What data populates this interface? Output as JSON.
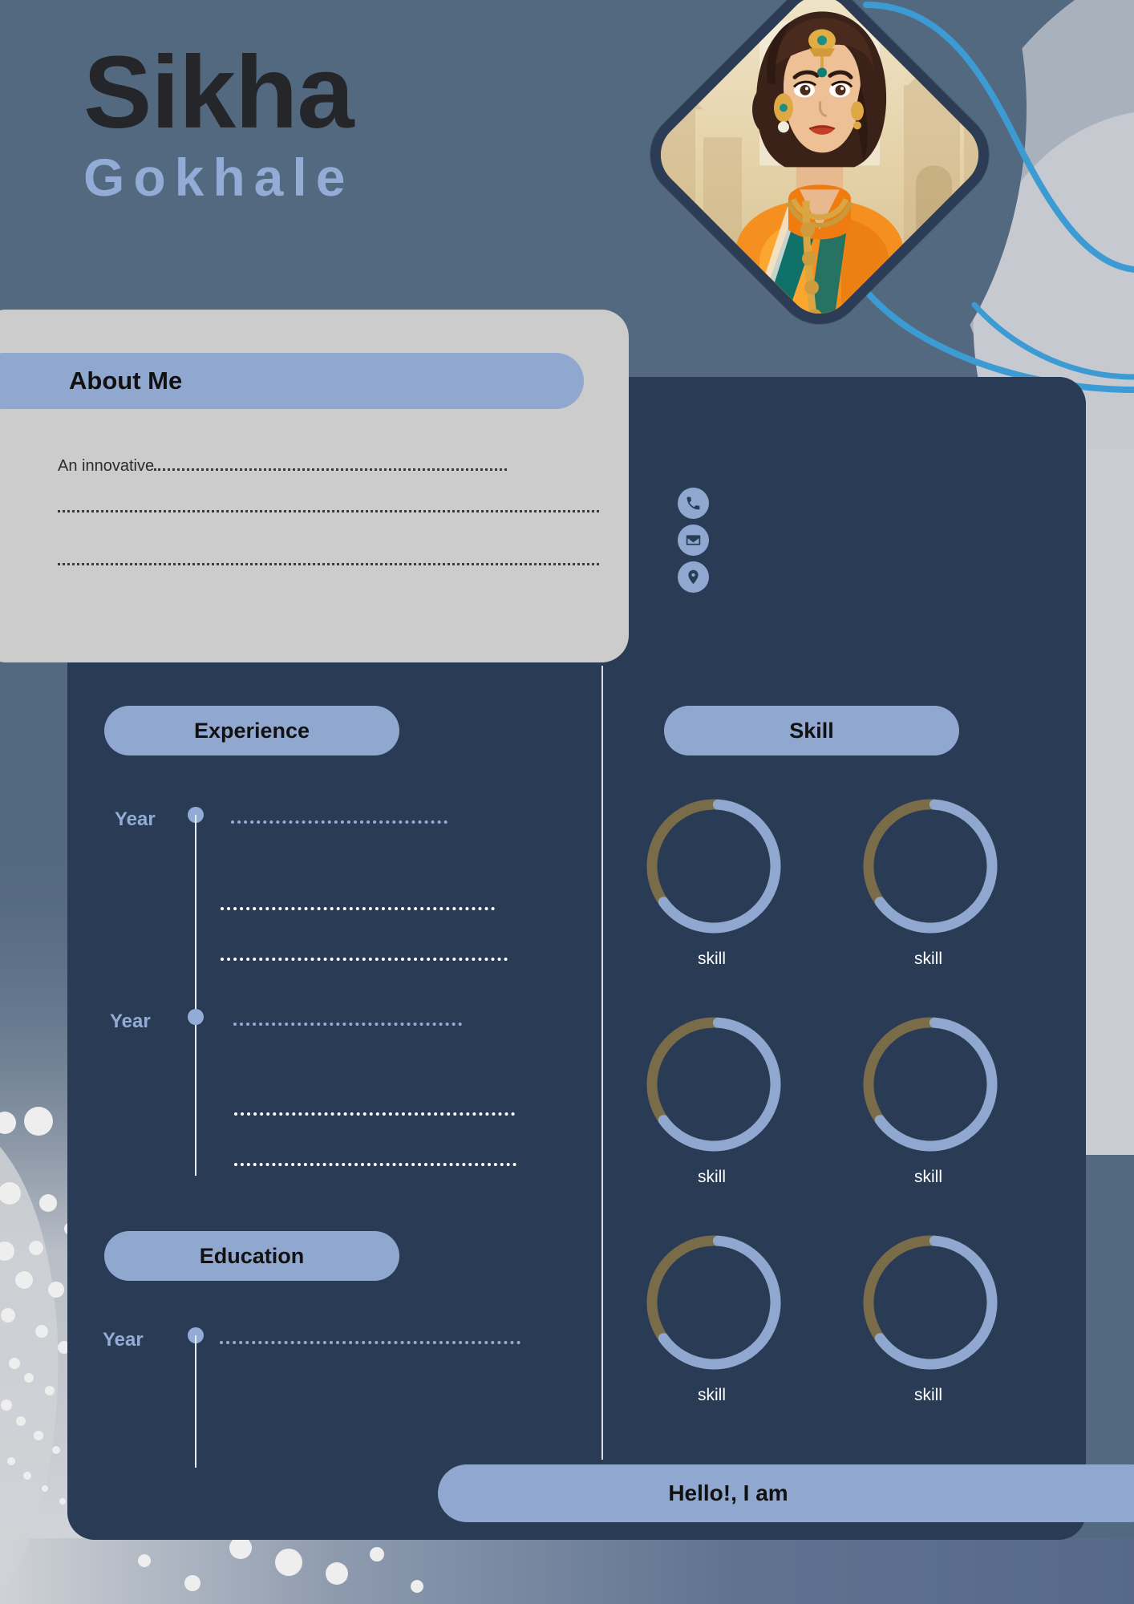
{
  "page": {
    "background_color": "#5a6f8c",
    "card_navy": "#2a3c55",
    "card_light": "#cccccc",
    "accent_periwinkle": "#90a8d0",
    "accent_blue_line": "#3d9bd4",
    "skill_ring_olive": "#7a6c48",
    "text_dark": "#24262a"
  },
  "header": {
    "first_name": "Sikha",
    "last_name": "Gokhale"
  },
  "photo": {
    "alt": "portrait-illustration-woman-in-orange-saree"
  },
  "about": {
    "title": "About Me",
    "body_text": "An innovative",
    "line_2": "",
    "line_3": ""
  },
  "contacts": [
    {
      "icon": "phone-icon",
      "value": ""
    },
    {
      "icon": "email-icon",
      "value": ""
    },
    {
      "icon": "location-icon",
      "value": ""
    }
  ],
  "experience": {
    "title": "Experience",
    "entries": [
      {
        "year_label": "Year",
        "detail_1": "",
        "detail_2": "",
        "detail_3": ""
      },
      {
        "year_label": "Year",
        "detail_1": "",
        "detail_2": "",
        "detail_3": ""
      }
    ]
  },
  "education": {
    "title": "Education",
    "entries": [
      {
        "year_label": "Year",
        "detail_1": ""
      }
    ]
  },
  "skills": {
    "title": "Skill",
    "items": [
      {
        "label": "skill",
        "percent": 64
      },
      {
        "label": "skill",
        "percent": 64
      },
      {
        "label": "skill",
        "percent": 64
      },
      {
        "label": "skill",
        "percent": 64
      },
      {
        "label": "skill",
        "percent": 64
      },
      {
        "label": "skill",
        "percent": 64
      }
    ]
  },
  "footer": {
    "tagline": "Hello!, I am"
  }
}
